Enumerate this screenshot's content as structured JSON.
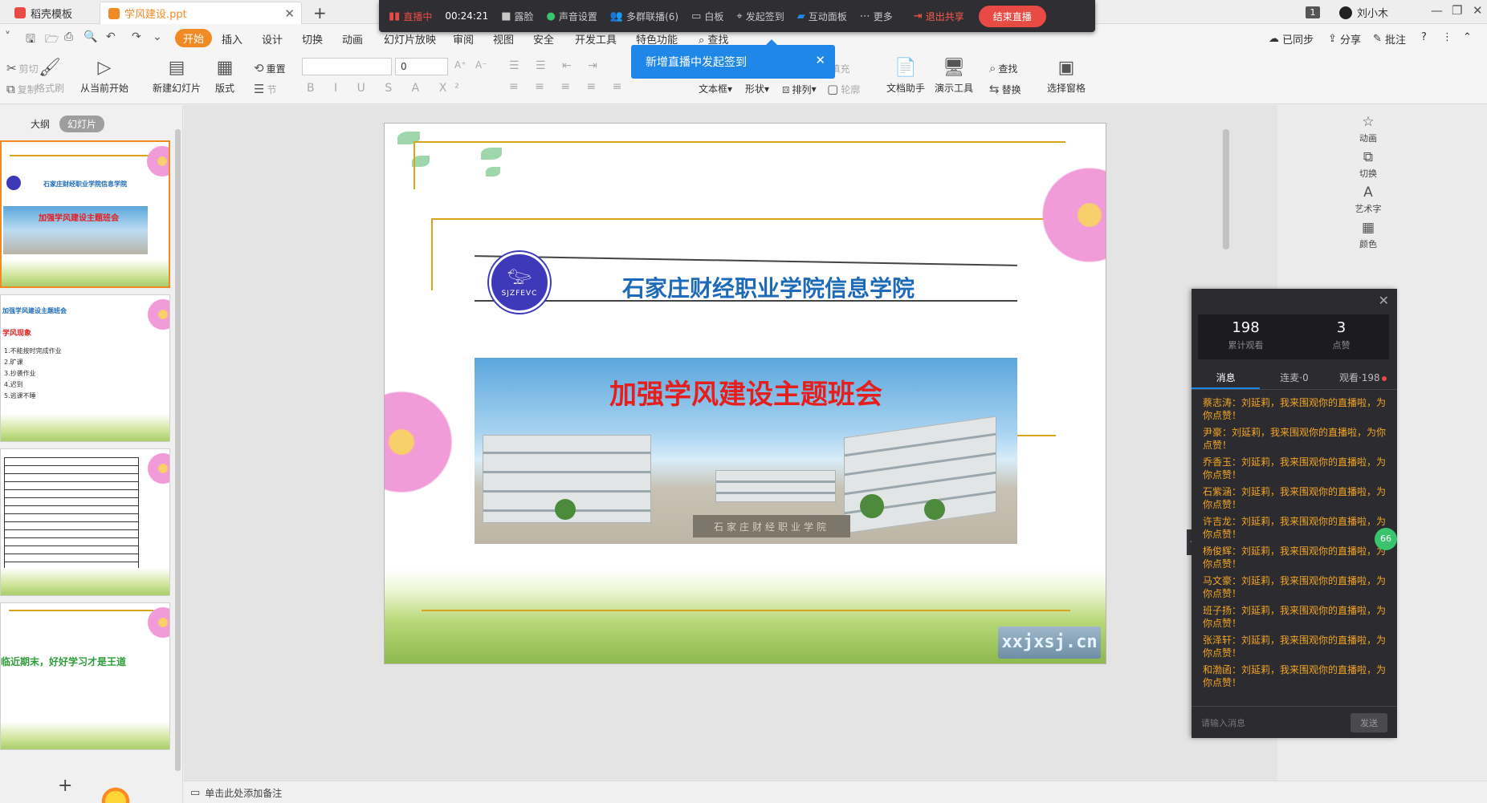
{
  "tabs": [
    {
      "label": "稻壳模板",
      "color": "#e84b43"
    },
    {
      "label": "学风建设.ppt",
      "color": "#f08a24"
    }
  ],
  "titlebar": {
    "badge": "1",
    "user_name": "刘小木"
  },
  "live_bar": {
    "status": "直播中",
    "time": "00:24:21",
    "items": [
      "露脸",
      "声音设置",
      "多群联播(6)",
      "白板",
      "发起签到",
      "互动面板",
      "更多"
    ],
    "exit_label": "退出共享",
    "end_label": "结束直播"
  },
  "tooltip": {
    "text": "新增直播中发起签到"
  },
  "menus": [
    "开始",
    "插入",
    "设计",
    "切换",
    "动画",
    "幻灯片放映",
    "审阅",
    "视图",
    "安全",
    "开发工具",
    "特色功能"
  ],
  "search_menu": "查找",
  "right_menus": [
    "已同步",
    "分享",
    "批注"
  ],
  "toolbar": {
    "cut": "剪切",
    "copy": "复制",
    "format_painter": "格式刷",
    "play_from_current": "从当前开始",
    "new_slide": "新建幻灯片",
    "layout": "版式",
    "reset": "重置",
    "section": "节",
    "font_name": "",
    "font_size": "0",
    "text_box": "文本框",
    "shape": "形状",
    "arrange": "排列",
    "outline": "轮廓",
    "fill": "填充",
    "doc_assistant": "文档助手",
    "present_tools": "演示工具",
    "find": "查找",
    "replace": "替换",
    "selection_pane": "选择窗格"
  },
  "left_panel": {
    "outline_tab": "大纲",
    "slides_tab": "幻灯片",
    "thumb1": {
      "college": "石家庄财经职业学院信息学院",
      "title": "加强学风建设主题班会"
    },
    "thumb2": {
      "title": "加强学风建设主题班会",
      "subtitle": "学风现象",
      "items": [
        "1.不能按时完成作业",
        "2.旷课",
        "3.抄袭作业",
        "4.迟到",
        "5.逃课不睡"
      ]
    },
    "thumb4": {
      "text": "临近期末，好好学习才是王道"
    }
  },
  "slide": {
    "logo_abbr": "SJZFEVC",
    "college_name": "石家庄财经职业学院信息学院",
    "title": "加强学风建设主题班会",
    "plaque": "石家庄财经职业学院",
    "watermark": "xxjxsj.cn"
  },
  "side_tools": [
    "动画",
    "切换",
    "艺术字",
    "颜色"
  ],
  "chat": {
    "total_views": "198",
    "total_views_label": "累计观看",
    "likes": "3",
    "likes_label": "点赞",
    "tabs": [
      "消息",
      "连麦·0",
      "观看·198"
    ],
    "messages": [
      "蔡志涛：刘延莉，我来围观你的直播啦，为你点赞！",
      "尹豪：刘延莉，我来围观你的直播啦，为你点赞！",
      "乔香玉：刘延莉，我来围观你的直播啦，为你点赞！",
      "石紫涵：刘延莉，我来围观你的直播啦，为你点赞！",
      "许吉龙：刘延莉，我来围观你的直播啦，为你点赞！",
      "杨俊辉：刘延莉，我来围观你的直播啦，为你点赞！",
      "马文豪：刘延莉，我来围观你的直播啦，为你点赞！",
      "班子扬：刘延莉，我来围观你的直播啦，为你点赞！",
      "张泽轩：刘延莉，我来围观你的直播啦，为你点赞！",
      "和渤函：刘延莉，我来围观你的直播啦，为你点赞！"
    ],
    "input_placeholder": "请输入消息",
    "send_label": "发送",
    "badge": "66"
  },
  "status": {
    "notes_placeholder": "单击此处添加备注"
  },
  "colors": {
    "accent": "#f08a24",
    "live_red": "#e84b43",
    "blue": "#1f87e8",
    "title_red": "#e51e1e",
    "college_blue": "#1d6bb8"
  }
}
